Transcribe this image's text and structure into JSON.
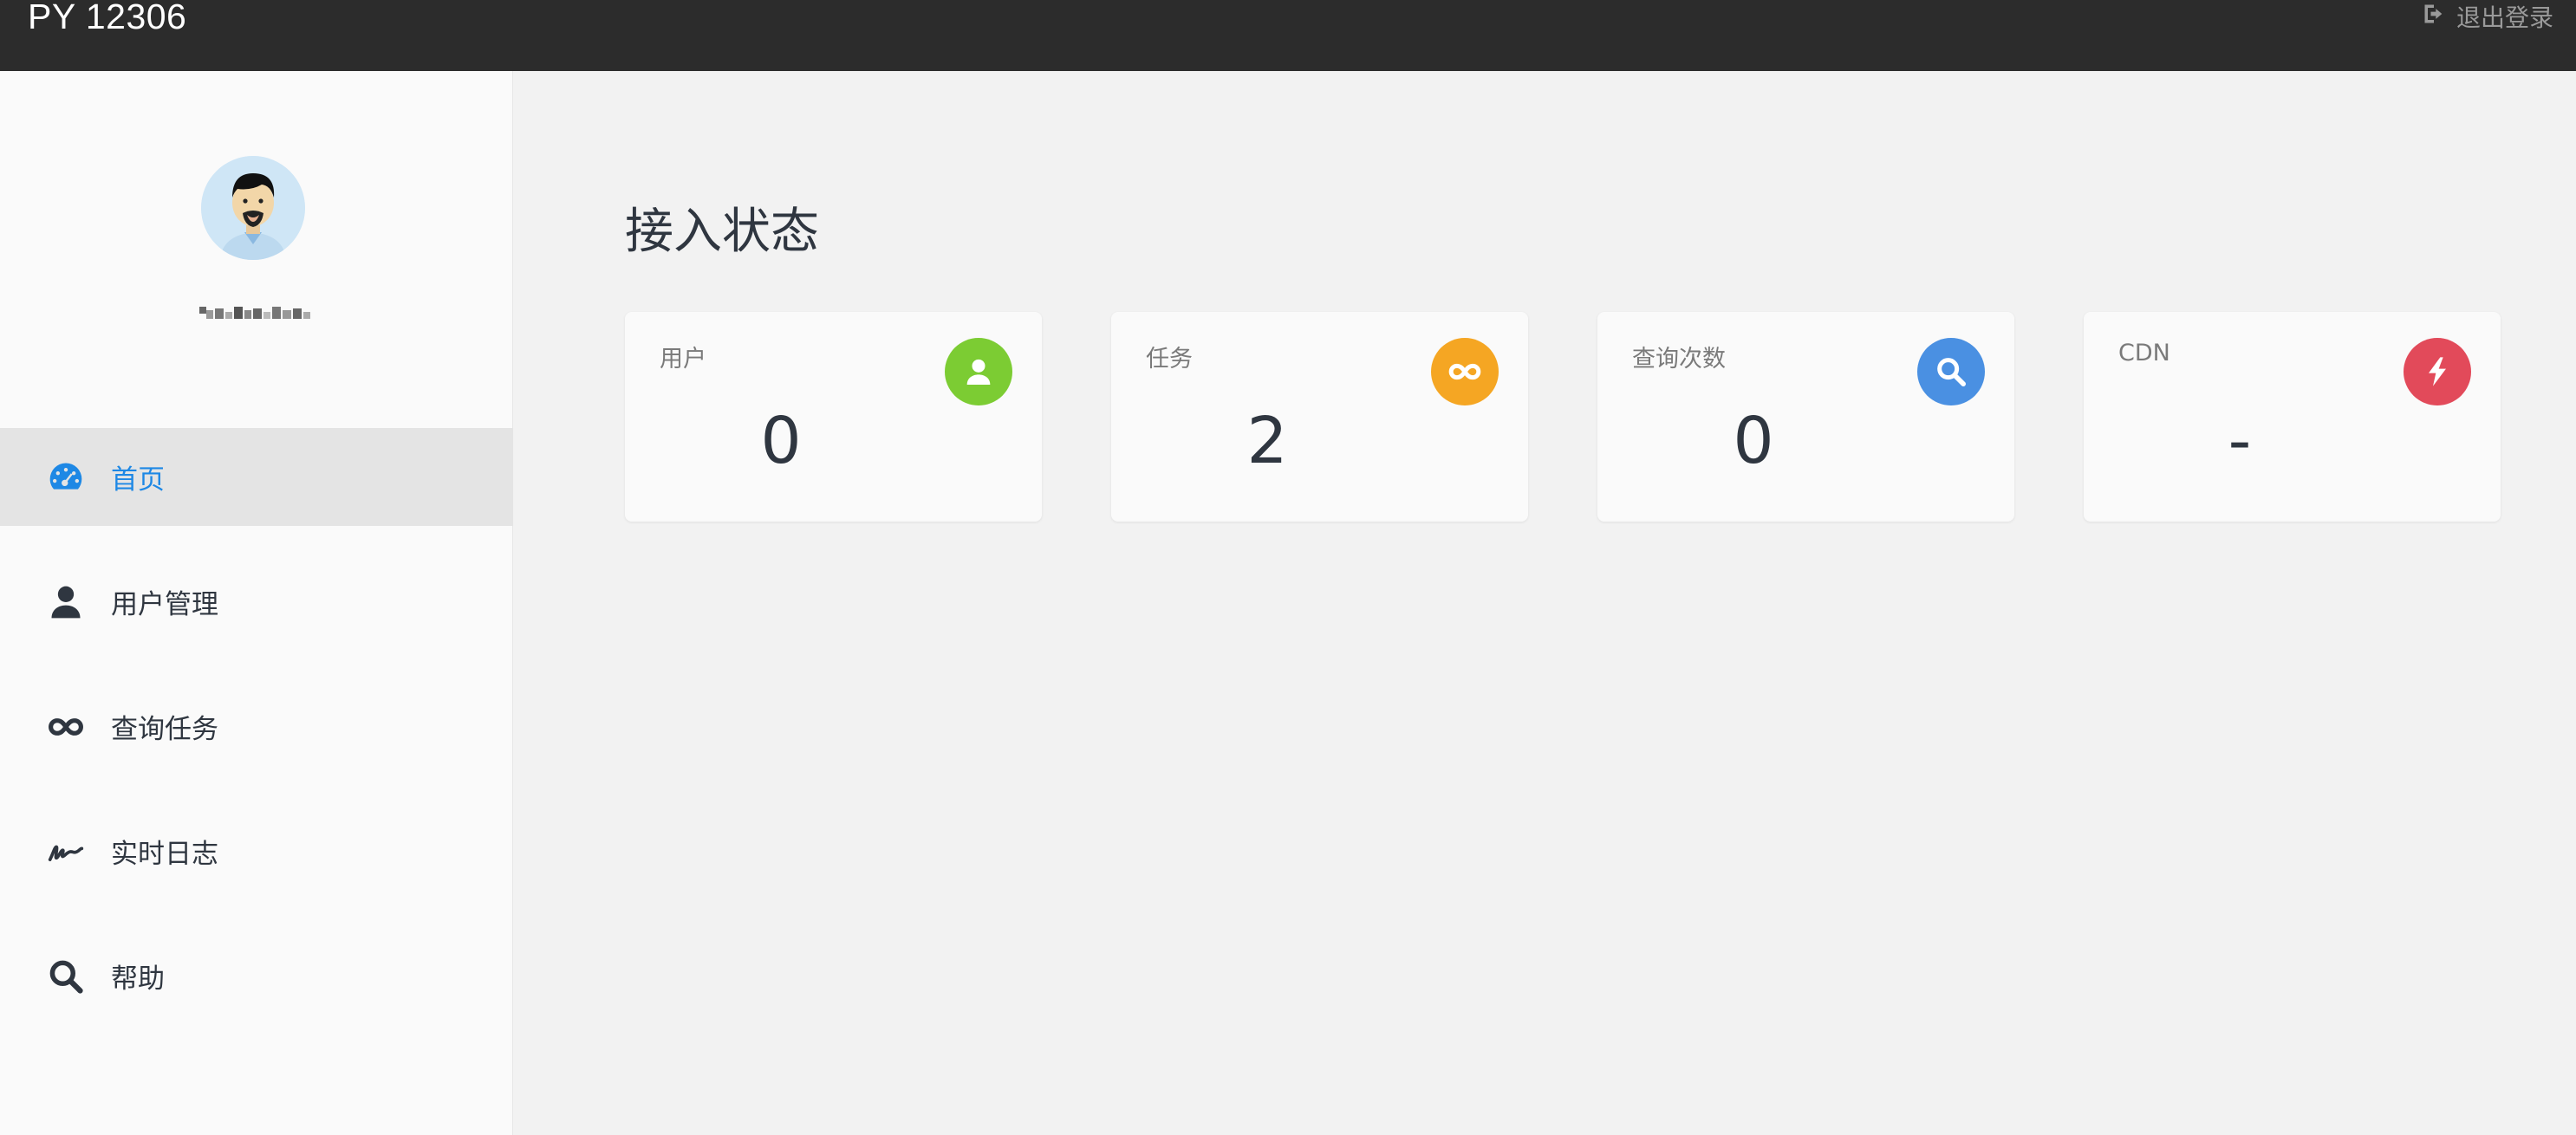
{
  "app": {
    "title": "PY 12306"
  },
  "header": {
    "logout_label": "退出登录",
    "logout_icon": "sign-out-icon"
  },
  "user": {
    "avatar_icon": "avatar-bearded-man"
  },
  "sidebar": {
    "items": [
      {
        "label": "首页",
        "icon": "dashboard-gauge-icon",
        "active": true
      },
      {
        "label": "用户管理",
        "icon": "user-icon",
        "active": false
      },
      {
        "label": "查询任务",
        "icon": "infinity-icon",
        "active": false
      },
      {
        "label": "实时日志",
        "icon": "signature-icon",
        "active": false
      },
      {
        "label": "帮助",
        "icon": "search-icon",
        "active": false
      }
    ]
  },
  "main": {
    "title": "接入状态",
    "cards": [
      {
        "label": "用户",
        "value": "0",
        "icon": "user-icon",
        "color": "#7ccc33"
      },
      {
        "label": "任务",
        "value": "2",
        "icon": "infinity-icon",
        "color": "#f5a623"
      },
      {
        "label": "查询次数",
        "value": "0",
        "icon": "search-icon",
        "color": "#4a90e2"
      },
      {
        "label": "CDN",
        "value": "-",
        "icon": "bolt-icon",
        "color": "#e24a5a"
      }
    ]
  },
  "colors": {
    "accent": "#1e88e5",
    "topbar": "#2c2c2c"
  }
}
